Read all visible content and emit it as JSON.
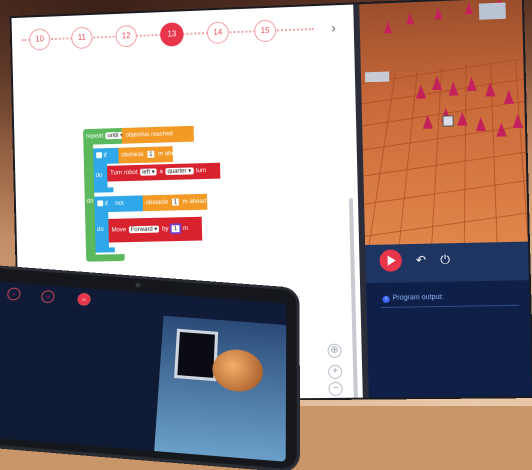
{
  "levels": [
    {
      "label": "10",
      "active": false
    },
    {
      "label": "11",
      "active": false
    },
    {
      "label": "12",
      "active": false
    },
    {
      "label": "13",
      "active": true
    },
    {
      "label": "14",
      "active": false
    },
    {
      "label": "15",
      "active": false
    }
  ],
  "next_chevron": "›",
  "blocks": {
    "repeat_label": "repeat",
    "repeat_mode": "until ▾",
    "repeat_condition": "objective reached",
    "do_outer": "do",
    "if1_label": "if",
    "if1_condition_prefix": "obstacle",
    "if1_distance": "1",
    "if1_condition_suffix": "m ahead",
    "if1_do": "do",
    "turn_prefix": "Turn robot",
    "turn_dir": "left ▾",
    "turn_joiner": "a",
    "turn_amount": "quarter ▾",
    "turn_suffix": "turn",
    "if2_label": "if",
    "if2_not": "not",
    "if2_condition_prefix": "obstacle",
    "if2_distance": "1",
    "if2_condition_suffix": "m ahead",
    "if2_do": "do",
    "move_prefix": "Move",
    "move_dir": "Forward ▾",
    "move_by": "by",
    "move_amount": "1",
    "move_unit": "m"
  },
  "zoom_controls": {
    "recenter": "⊕",
    "zoom_in": "+",
    "zoom_out": "−"
  },
  "controls": {
    "undo": "↶",
    "power": "⏻"
  },
  "output": {
    "info": "i",
    "title": "Program output:"
  },
  "tablet": {
    "levels": [
      "9",
      "10",
      "11"
    ],
    "active_index": 2
  },
  "colors": {
    "accent": "#e8354a",
    "block_green": "#5cb85c",
    "block_blue": "#2ea8e8",
    "block_orange": "#f39a26",
    "block_red": "#d8232f",
    "panel_navy": "#0e2048"
  }
}
